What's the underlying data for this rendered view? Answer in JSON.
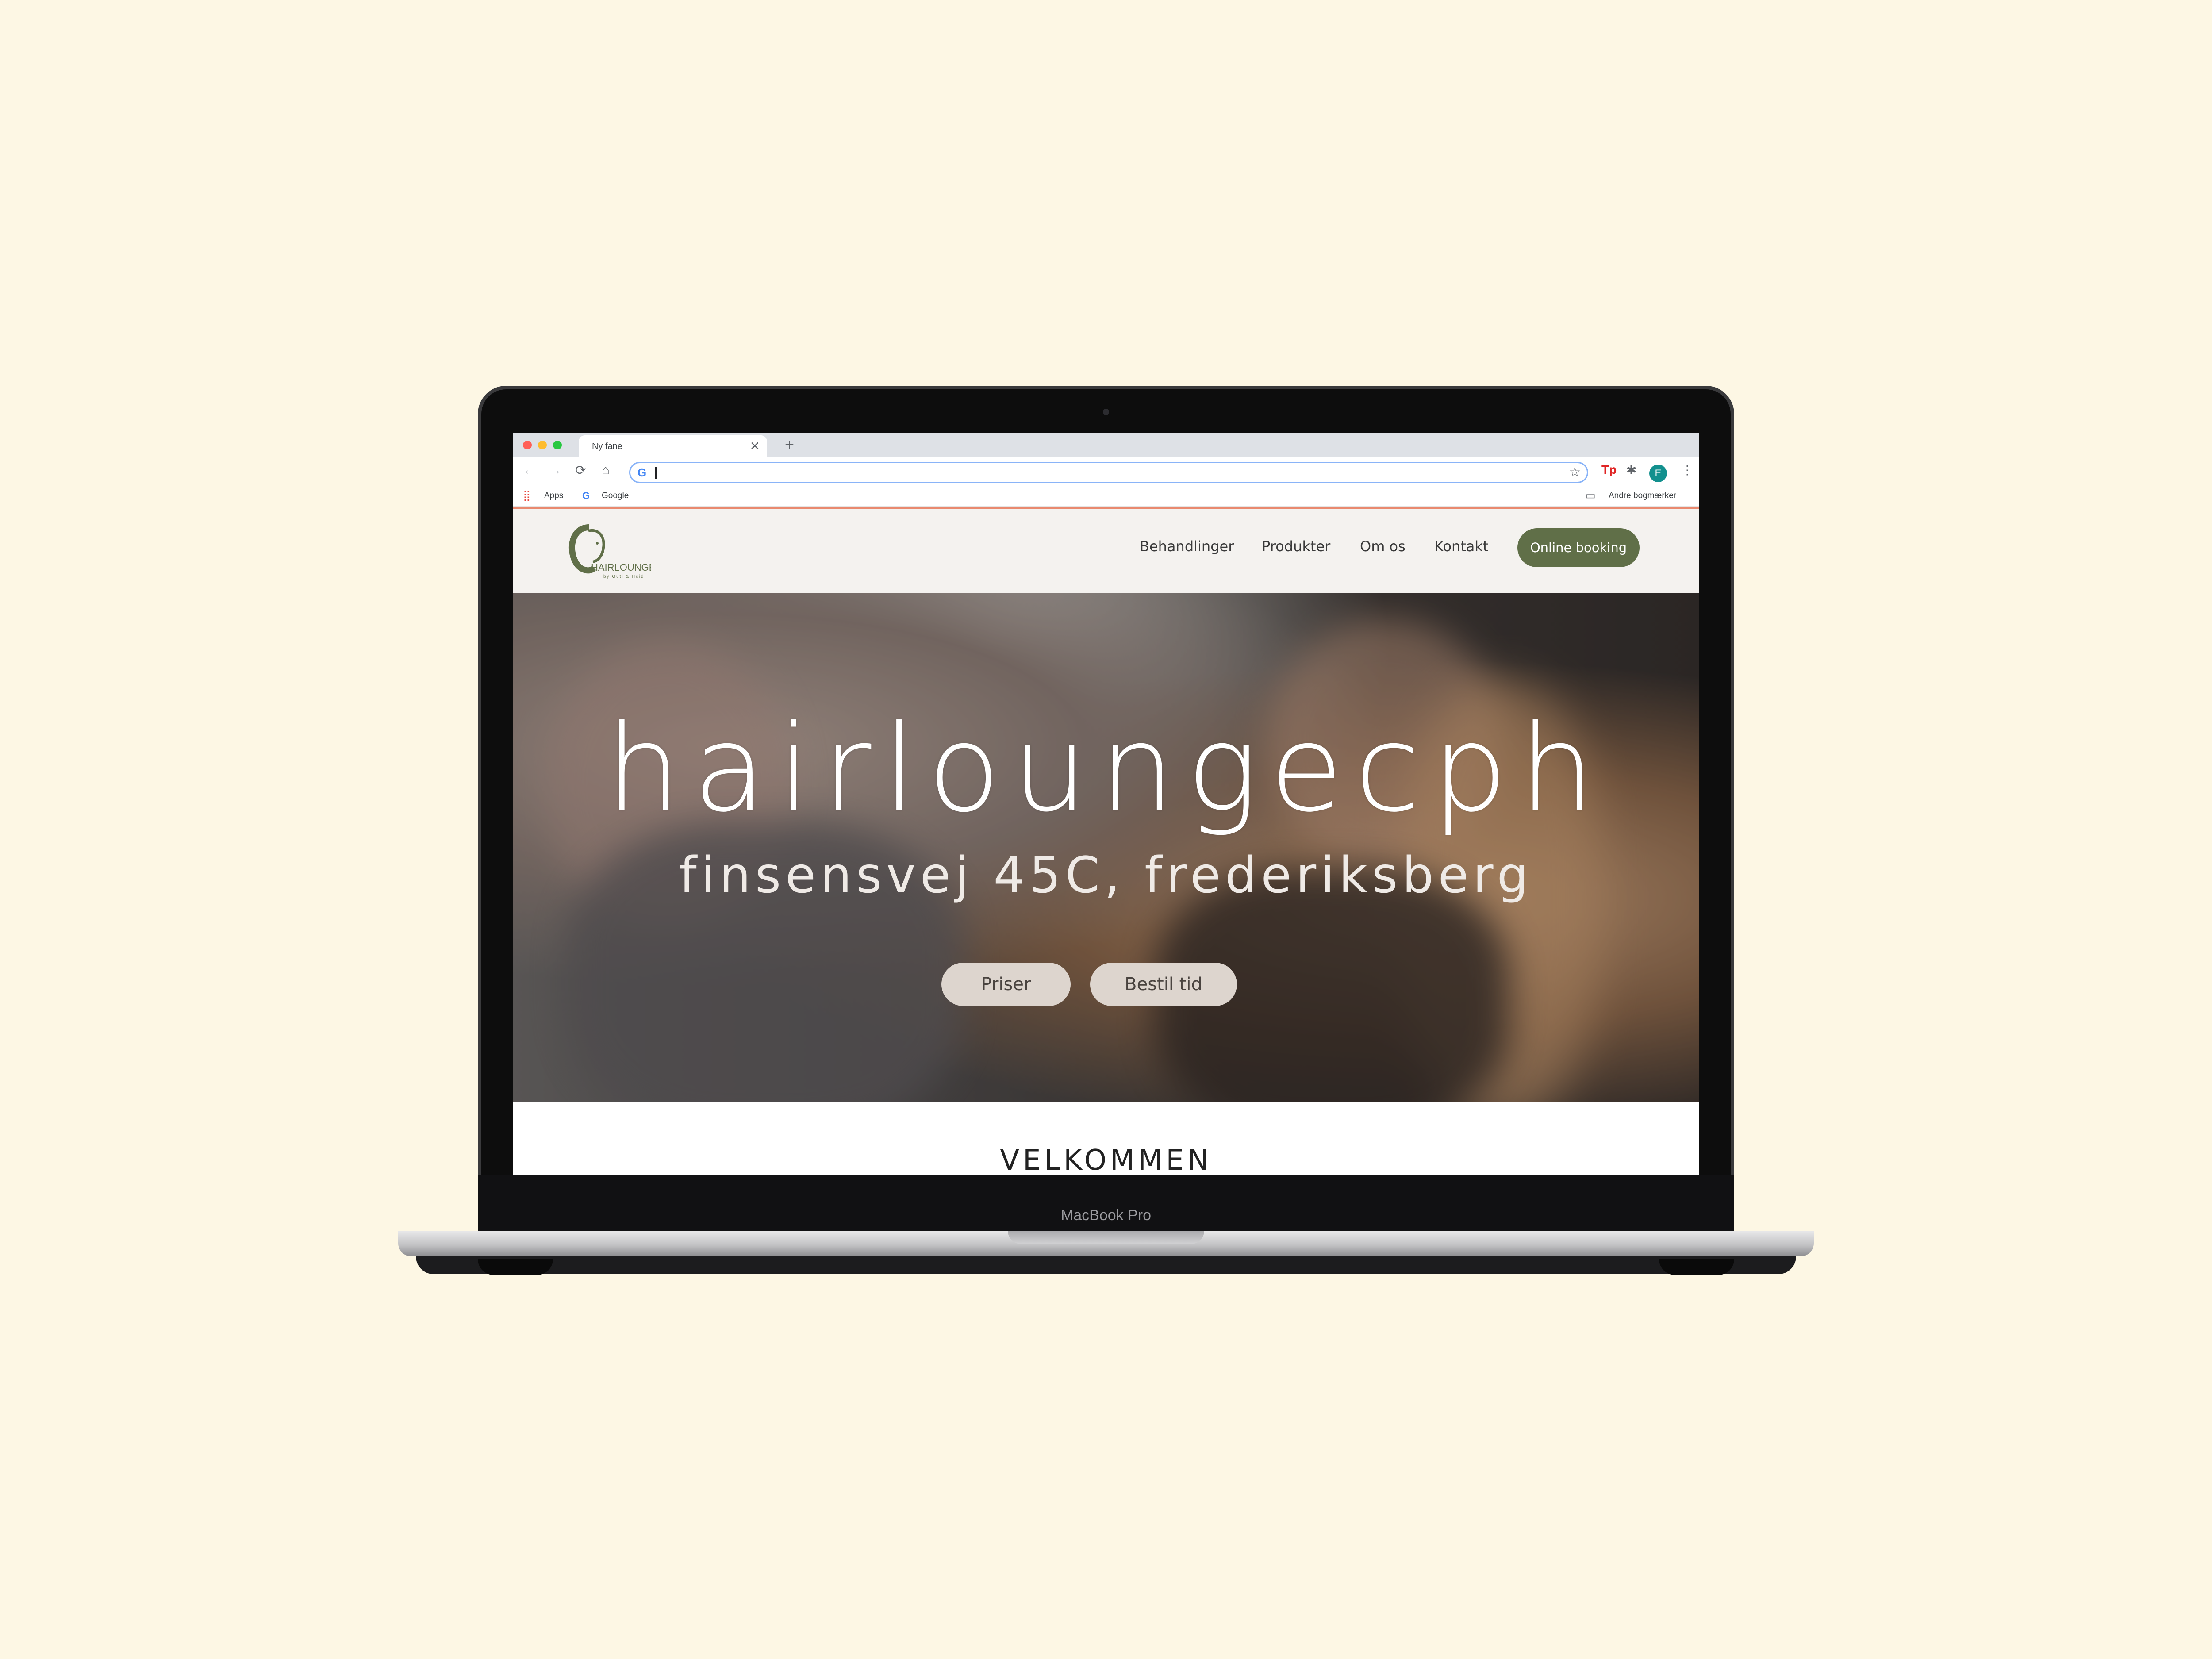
{
  "device": {
    "label": "MacBook Pro"
  },
  "browser": {
    "tab_title": "Ny fane",
    "tab_close": "✕",
    "new_tab": "+",
    "back": "←",
    "forward": "→",
    "reload": "⟳",
    "home": "⌂",
    "omnibox_value": "",
    "bookmarks": {
      "apps_label": "Apps",
      "google_label": "Google",
      "other_label": "Andre bogmærker"
    },
    "profile_initial": "E"
  },
  "site": {
    "logo_text": "HAIRLOUNGE",
    "logo_subtext": "by Guti & Heidi",
    "nav": [
      {
        "label": "Behandlinger"
      },
      {
        "label": "Produkter"
      },
      {
        "label": "Om os"
      },
      {
        "label": "Kontakt"
      }
    ],
    "cta_label": "Online booking",
    "hero": {
      "title": "hairloungecph",
      "subtitle": "finsensvej 45C, frederiksberg",
      "buttons": [
        {
          "label": "Priser"
        },
        {
          "label": "Bestil tid"
        }
      ]
    },
    "welcome_heading": "VELKOMMEN"
  },
  "colors": {
    "page_background": "#fdf7e4",
    "brand_green": "#606f48",
    "accent_line": "#e9896f",
    "hero_button": "#ddd5ce"
  }
}
